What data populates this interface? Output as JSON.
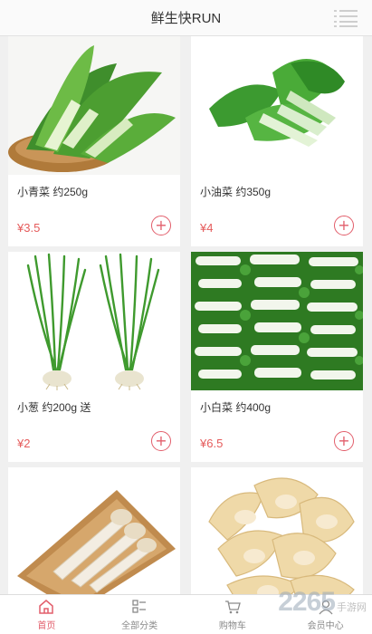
{
  "header": {
    "title": "鲜生快RUN",
    "menu_icon": "menu-lines-icon"
  },
  "products": [
    {
      "name": "小青菜 约250g",
      "price": "¥3.5",
      "image": "bok-choy-basket"
    },
    {
      "name": "小油菜 约350g",
      "price": "¥4",
      "image": "rapeseed-greens"
    },
    {
      "name": "小葱 约200g 送",
      "price": "¥2",
      "image": "green-onion"
    },
    {
      "name": "小白菜 约400g",
      "price": "¥6.5",
      "image": "pak-choi-rows"
    },
    {
      "name": "",
      "price": "",
      "image": "king-oyster-mushroom"
    },
    {
      "name": "",
      "price": "",
      "image": "white-fungus"
    }
  ],
  "add_symbol": "+",
  "tabbar": [
    {
      "label": "首页",
      "icon": "home-icon",
      "active": true
    },
    {
      "label": "全部分类",
      "icon": "category-icon",
      "active": false
    },
    {
      "label": "购物车",
      "icon": "cart-icon",
      "active": false
    },
    {
      "label": "会员中心",
      "icon": "member-icon",
      "active": false
    }
  ],
  "watermark": {
    "number": "2265",
    "suffix": "手游网"
  },
  "colors": {
    "accent": "#e25e6b",
    "price": "#e55b5b"
  }
}
